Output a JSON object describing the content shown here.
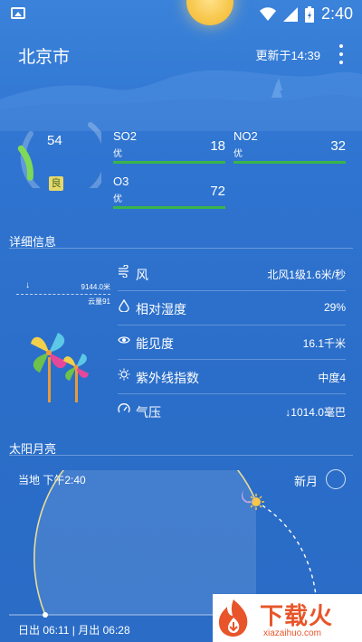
{
  "status_bar": {
    "time": "2:40",
    "icons": [
      "image-icon",
      "wifi-icon",
      "signal-icon",
      "battery-charging-icon"
    ]
  },
  "header": {
    "city": "北京市",
    "updated": "更新于14:39",
    "menu_icon": "more-vert-icon"
  },
  "air_quality": {
    "aqi": "54",
    "level": "良",
    "aqi_fraction": 0.18,
    "pollutants": [
      {
        "name": "SO2",
        "grade": "优",
        "value": "18"
      },
      {
        "name": "NO2",
        "grade": "优",
        "value": "32"
      },
      {
        "name": "O3",
        "grade": "优",
        "value": "72"
      }
    ]
  },
  "details": {
    "title": "详细信息",
    "visibility_small": "9144.0米",
    "cloud_small": "云量91",
    "rows": [
      {
        "icon": "wind-icon",
        "label": "风",
        "value": "北风1级1.6米/秒"
      },
      {
        "icon": "humidity-drop-icon",
        "label": "相对湿度",
        "value": "29%"
      },
      {
        "icon": "eye-icon",
        "label": "能见度",
        "value": "16.1千米"
      },
      {
        "icon": "sun-uv-icon",
        "label": "紫外线指数",
        "value": "中度4"
      },
      {
        "icon": "pressure-gauge-icon",
        "label": "气压",
        "value": "↓1014.0毫巴"
      }
    ]
  },
  "sun_moon": {
    "title": "太阳月亮",
    "local_time": "当地 下午2:40",
    "moon_phase": "新月",
    "rise_times": "日出 06:11 | 月出 06:28"
  },
  "watermark": {
    "name": "下载火",
    "url": "xiazaihuo.com"
  },
  "colors": {
    "background": "#2f74d0",
    "pollutant_bar": "#3ab54a",
    "aqi_good_badge": "#e7d86a",
    "sun": "#f7c64a",
    "watermark_orange": "#e8552a"
  }
}
